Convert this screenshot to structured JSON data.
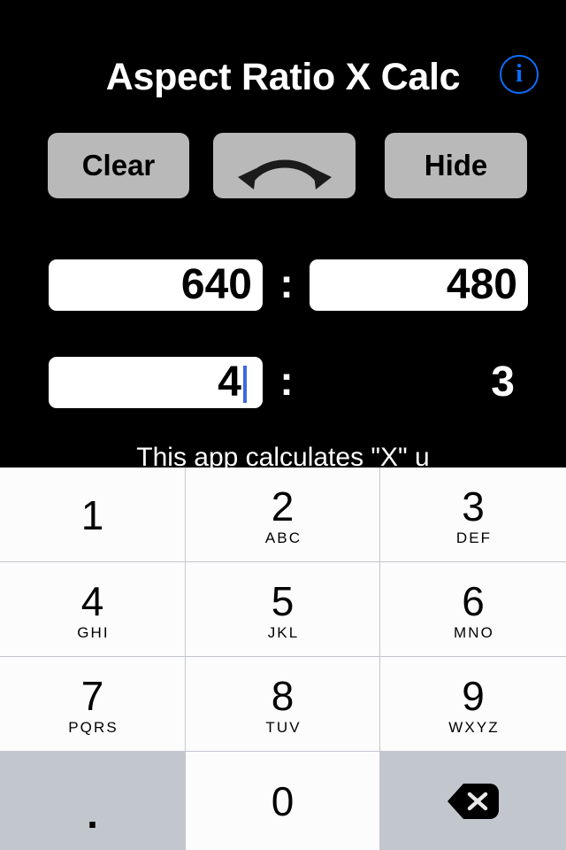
{
  "app": {
    "title": "Aspect Ratio X Calc",
    "info_icon": "info-circle-icon",
    "background_color": "#000000",
    "accent_color": "#0a6efd"
  },
  "toolbar": {
    "clear_label": "Clear",
    "swap_icon": "swap-curved-double-arrow-icon",
    "hide_label": "Hide",
    "button_color": "#b9b9b9"
  },
  "ratio": {
    "source": {
      "width_value": "640",
      "width_placeholder": "",
      "separator": ":",
      "height_value": "480",
      "height_placeholder": ""
    },
    "result": {
      "x_value": "4",
      "x_placeholder": "",
      "separator": ":",
      "y_value": "3"
    },
    "caret_color": "#3b68e0"
  },
  "description": {
    "text": "This app calculates \"X\" u"
  },
  "keyboard": {
    "keys": [
      {
        "digit": "1",
        "letters": ""
      },
      {
        "digit": "2",
        "letters": "ABC"
      },
      {
        "digit": "3",
        "letters": "DEF"
      },
      {
        "digit": "4",
        "letters": "GHI"
      },
      {
        "digit": "5",
        "letters": "JKL"
      },
      {
        "digit": "6",
        "letters": "MNO"
      },
      {
        "digit": "7",
        "letters": "PQRS"
      },
      {
        "digit": "8",
        "letters": "TUV"
      },
      {
        "digit": "9",
        "letters": "WXYZ"
      },
      {
        "digit": ".",
        "letters": ""
      },
      {
        "digit": "0",
        "letters": ""
      },
      {
        "digit": "",
        "letters": "",
        "icon": "backspace-delete-icon"
      }
    ],
    "background_color": "#fcfcfc",
    "special_key_color": "#c2c6cd"
  }
}
